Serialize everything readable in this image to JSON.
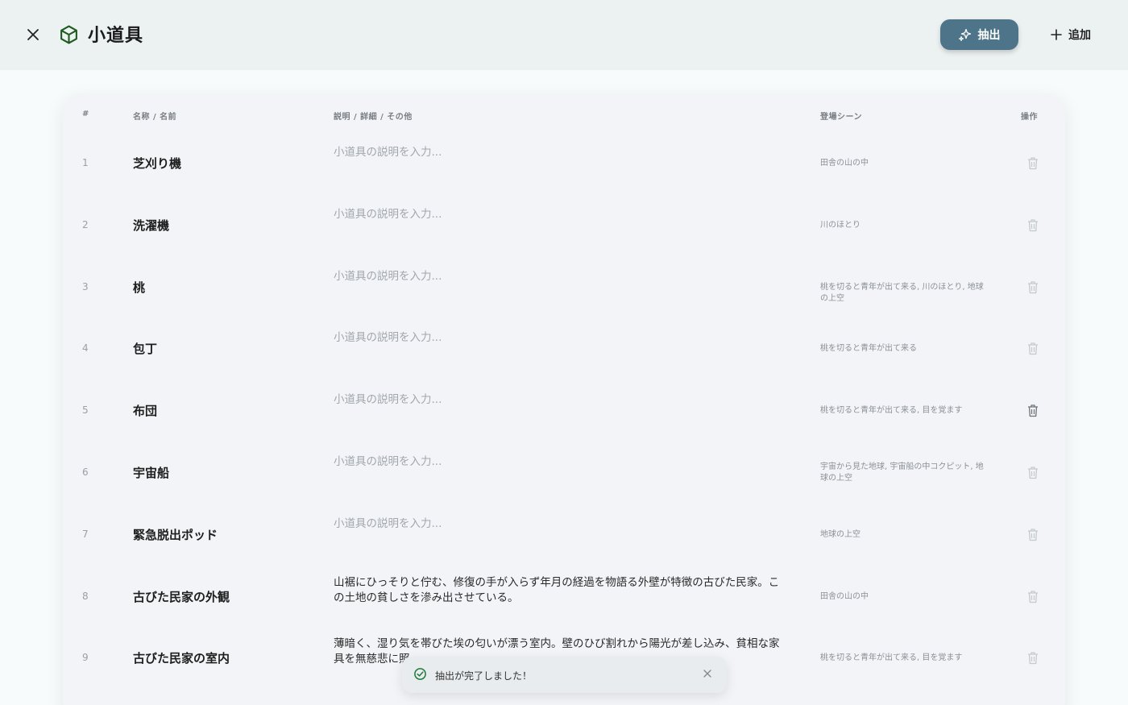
{
  "header": {
    "title": "小道具",
    "extract_label": "抽出",
    "add_label": "追加"
  },
  "colors": {
    "accent": "#4d7488",
    "icon_green": "#1e5a1e",
    "header_bg": "#ecf1f1"
  },
  "table": {
    "columns": {
      "num": "#",
      "name": "名称 / 名前",
      "desc": "説明 / 詳細 / その他",
      "scene": "登場シーン",
      "action": "操作"
    },
    "rows": [
      {
        "num": "1",
        "name": "芝刈り機",
        "desc": "小道具の説明を入力...",
        "placeholder": true,
        "scene": "田舎の山の中"
      },
      {
        "num": "2",
        "name": "洗濯機",
        "desc": "小道具の説明を入力...",
        "placeholder": true,
        "scene": "川のほとり"
      },
      {
        "num": "3",
        "name": "桃",
        "desc": "小道具の説明を入力...",
        "placeholder": true,
        "scene": "桃を切ると青年が出て来る, 川のほとり, 地球の上空"
      },
      {
        "num": "4",
        "name": "包丁",
        "desc": "小道具の説明を入力...",
        "placeholder": true,
        "scene": "桃を切ると青年が出て来る"
      },
      {
        "num": "5",
        "name": "布団",
        "desc": "小道具の説明を入力...",
        "placeholder": true,
        "scene": "桃を切ると青年が出て来る, 目を覚ます"
      },
      {
        "num": "6",
        "name": "宇宙船",
        "desc": "小道具の説明を入力...",
        "placeholder": true,
        "scene": "宇宙から見た地球, 宇宙船の中コクピット, 地球の上空"
      },
      {
        "num": "7",
        "name": "緊急脱出ポッド",
        "desc": "小道具の説明を入力...",
        "placeholder": true,
        "scene": "地球の上空"
      },
      {
        "num": "8",
        "name": "古びた民家の外観",
        "desc": "山裾にひっそりと佇む、修復の手が入らず年月の経過を物語る外壁が特徴の古びた民家。この土地の貧しさを滲み出させている。",
        "placeholder": false,
        "scene": "田舎の山の中"
      },
      {
        "num": "9",
        "name": "古びた民家の室内",
        "desc": "薄暗く、湿り気を帯びた埃の匂いが漂う室内。壁のひび割れから陽光が差し込み、貧相な家具を無慈悲に照",
        "placeholder": false,
        "scene": "桃を切ると青年が出て来る, 目を覚ます"
      }
    ]
  },
  "toast": {
    "message": "抽出が完了しました！"
  }
}
